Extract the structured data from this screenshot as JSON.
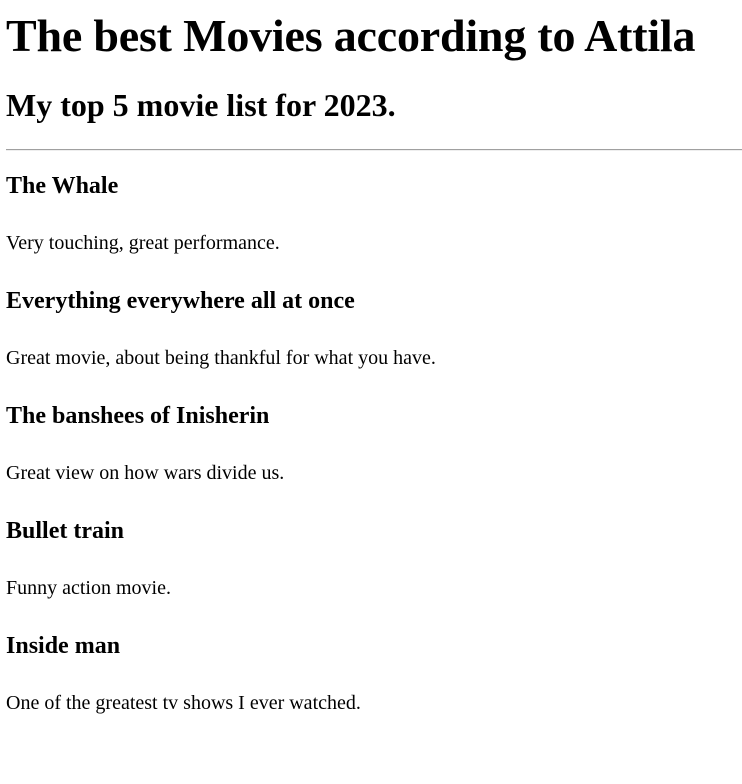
{
  "page": {
    "title": "The best Movies according to Attila",
    "subtitle": "My top 5 movie list for 2023."
  },
  "movies": [
    {
      "title": "The Whale",
      "review": "Very touching, great performance."
    },
    {
      "title": "Everything everywhere all at once",
      "review": "Great movie, about being thankful for what you have."
    },
    {
      "title": "The banshees of Inisherin",
      "review": "Great view on how wars divide us."
    },
    {
      "title": "Bullet train",
      "review": "Funny action movie."
    },
    {
      "title": "Inside man",
      "review": "One of the greatest tv shows I ever watched."
    }
  ]
}
